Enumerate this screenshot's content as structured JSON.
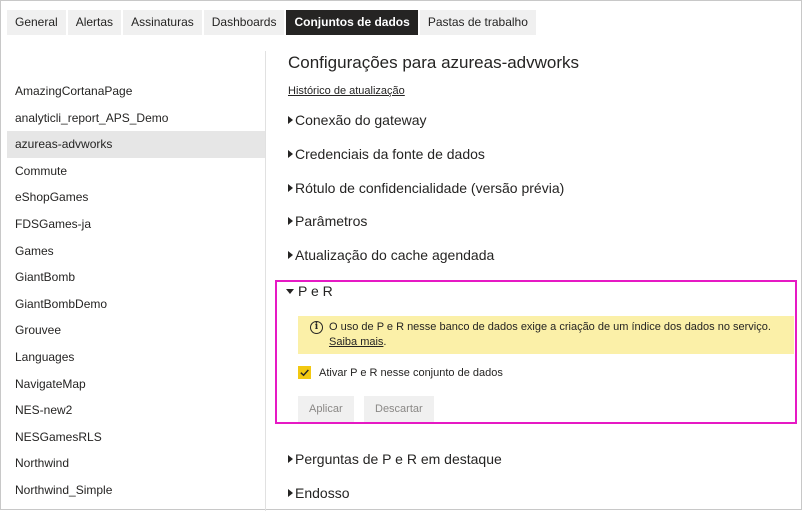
{
  "tabs": [
    {
      "label": "General",
      "active": false
    },
    {
      "label": "Alertas",
      "active": false
    },
    {
      "label": "Assinaturas",
      "active": false
    },
    {
      "label": "Dashboards",
      "active": false
    },
    {
      "label": "Conjuntos de dados",
      "active": true
    },
    {
      "label": "Pastas de trabalho",
      "active": false
    }
  ],
  "sidebar": {
    "items": [
      {
        "label": "AmazingCortanaPage"
      },
      {
        "label": "analyticli_report_APS_Demo"
      },
      {
        "label": "azureas-advworks",
        "selected": true
      },
      {
        "label": "Commute"
      },
      {
        "label": "eShopGames"
      },
      {
        "label": "FDSGames-ja"
      },
      {
        "label": "Games"
      },
      {
        "label": "GiantBomb"
      },
      {
        "label": "GiantBombDemo"
      },
      {
        "label": "Grouvee"
      },
      {
        "label": "Languages"
      },
      {
        "label": "NavigateMap"
      },
      {
        "label": "NES-new2"
      },
      {
        "label": "NESGamesRLS"
      },
      {
        "label": "Northwind"
      },
      {
        "label": "Northwind_Simple"
      }
    ]
  },
  "main": {
    "title": "Configurações para azureas-advworks",
    "history_link": "Histórico de atualização",
    "sections": [
      {
        "label": "Conexão do gateway"
      },
      {
        "label": "Credenciais da fonte de dados"
      },
      {
        "label": "Rótulo de confidencialidade (versão prévia)"
      },
      {
        "label": "Parâmetros"
      },
      {
        "label": "Atualização do cache agendada"
      }
    ],
    "qa": {
      "header": "P e R",
      "info_icon_glyph": "i",
      "warning_text": "O uso de P e R nesse banco de dados exige a criação de um índice dos dados no serviço.",
      "warning_link": "Saiba mais",
      "warning_period": ".",
      "checkbox_label": "Ativar P e R nesse conjunto de dados",
      "checkbox_checked": true,
      "apply_label": "Aplicar",
      "discard_label": "Descartar"
    },
    "sections_after": [
      {
        "label": "Perguntas de P e R em destaque"
      },
      {
        "label": "Endosso"
      }
    ]
  },
  "colors": {
    "highlight_border": "#e619c4",
    "warning_bg": "#fbf0a8",
    "checkbox_accent": "#f2c811",
    "active_tab_bg": "#252423"
  }
}
